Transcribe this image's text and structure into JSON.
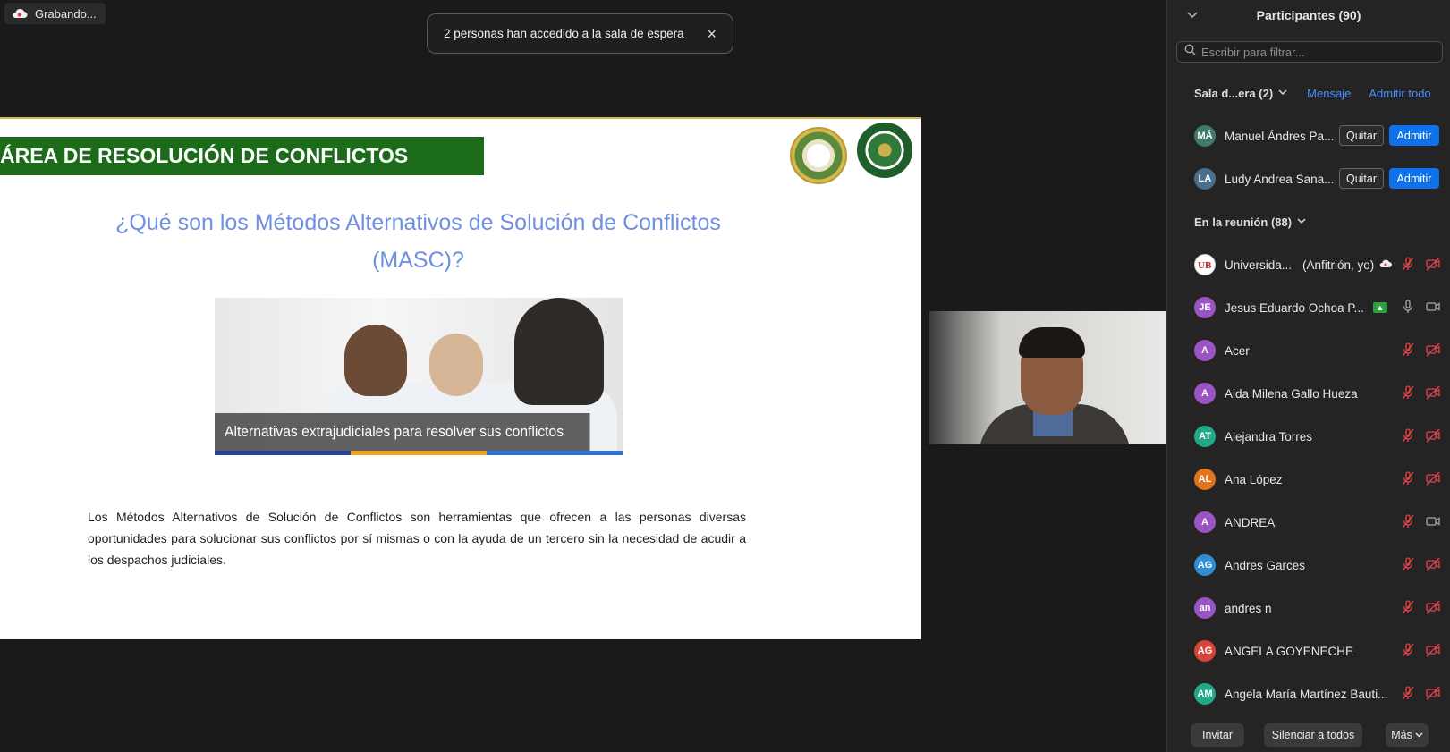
{
  "recording": {
    "label": "Grabando..."
  },
  "toast": {
    "message": "2 personas han accedido a la sala de espera",
    "close": "×"
  },
  "slide": {
    "banner": "ÁREA DE RESOLUCIÓN DE CONFLICTOS",
    "question_line1": "¿Qué son los Métodos Alternativos de Solución de Conflictos",
    "question_line2": "(MASC)?",
    "caption": "Alternativas extrajudiciales para resolver sus conflictos",
    "body": "Los Métodos Alternativos de Solución de Conflictos son herramientas que ofrecen a las personas diversas oportunidades para solucionar sus conflictos por sí mismas o con la ayuda de un tercero sin la necesidad de acudir a los despachos judiciales."
  },
  "panel": {
    "title": "Participantes (90)",
    "filter_placeholder": "Escribir para filtrar...",
    "waiting": {
      "label": "Sala d...era (2)",
      "message_link": "Mensaje",
      "admit_all_link": "Admitir todo",
      "people": [
        {
          "initials": "MÁ",
          "name": "Manuel Ándres Pa...",
          "color": "#3f7a6a",
          "remove": "Quitar",
          "admit": "Admitir"
        },
        {
          "initials": "LA",
          "name": "Ludy Andrea Sana...",
          "color": "#4a6f8c",
          "remove": "Quitar",
          "admit": "Admitir"
        }
      ]
    },
    "meeting": {
      "label": "En la reunión (88)",
      "people": [
        {
          "initials": "UB",
          "name": "Universida...",
          "tag": "(Anfitrión, yo)",
          "color": "#ffffff"
        },
        {
          "initials": "JE",
          "name": "Jesus Eduardo Ochoa P...",
          "color": "#9a55c4"
        },
        {
          "initials": "A",
          "name": "Acer",
          "color": "#9a55c4"
        },
        {
          "initials": "A",
          "name": "Aida Milena Gallo Hueza",
          "color": "#9a55c4"
        },
        {
          "initials": "AT",
          "name": "Alejandra Torres",
          "color": "#22a98a"
        },
        {
          "initials": "AL",
          "name": "Ana López",
          "color": "#e0741d"
        },
        {
          "initials": "A",
          "name": "ANDREA",
          "color": "#9a55c4"
        },
        {
          "initials": "AG",
          "name": "Andres Garces",
          "color": "#2f8fd6"
        },
        {
          "initials": "an",
          "name": "andres n",
          "color": "#9a55c4"
        },
        {
          "initials": "AG",
          "name": "ANGELA GOYENECHE",
          "color": "#d5453a"
        },
        {
          "initials": "AM",
          "name": "Angela María Martínez Bauti...",
          "color": "#22a98a"
        }
      ]
    },
    "footer": {
      "invite": "Invitar",
      "mute_all": "Silenciar a todos",
      "more": "Más"
    }
  }
}
